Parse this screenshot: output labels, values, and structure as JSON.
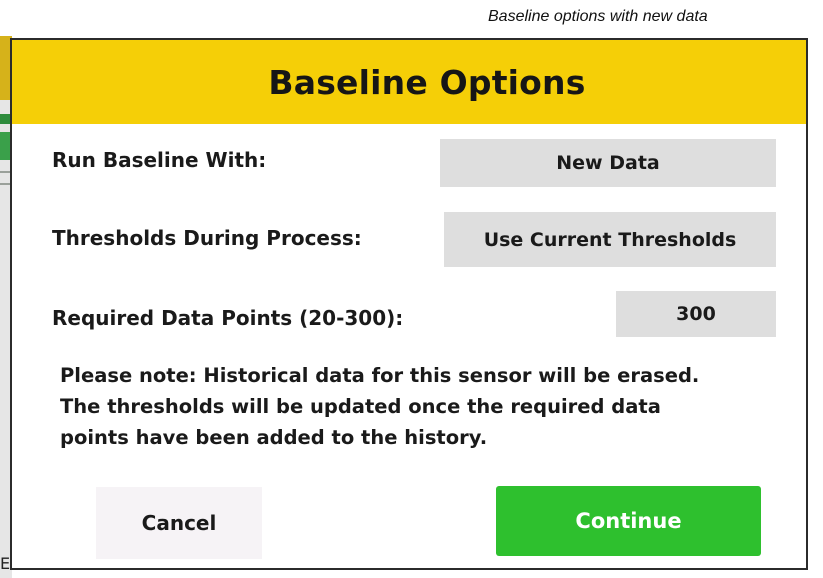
{
  "caption": "Baseline options with new data",
  "background_app": {
    "glyph": "E"
  },
  "dialog": {
    "title": "Baseline Options",
    "run_baseline": {
      "label": "Run Baseline With:",
      "value": "New Data"
    },
    "thresholds": {
      "label": "Thresholds During Process:",
      "value": "Use Current Thresholds"
    },
    "data_points": {
      "label": "Required Data Points (20-300):",
      "value": "300"
    },
    "note_lines": [
      "Please note: Historical data for this sensor will be erased.",
      "The thresholds will be updated once the required data",
      "points have been added to the history."
    ],
    "cancel_label": "Cancel",
    "continue_label": "Continue"
  },
  "colors": {
    "header": "#f5cf07",
    "continue": "#2ec02e",
    "option_button": "#dedede",
    "cancel_button": "#f6f3f6"
  }
}
